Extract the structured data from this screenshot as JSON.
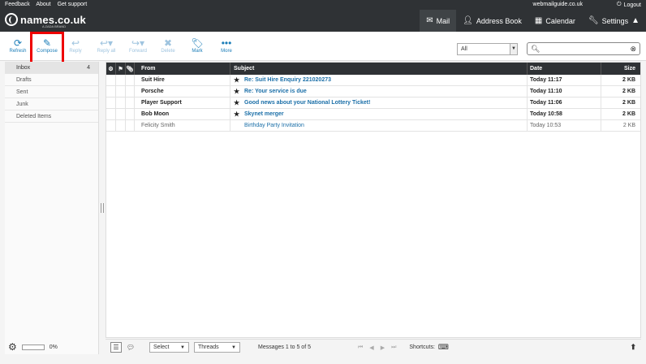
{
  "app": {
    "brand": "names.co.uk",
    "brand_sub": "A ZADA BRAND",
    "top_links": [
      "Feedback",
      "About",
      "Get support"
    ],
    "username": "webmailguide.co.uk",
    "logout_label": "Logout"
  },
  "nav": {
    "mail": "Mail",
    "address_book": "Address Book",
    "calendar": "Calendar",
    "settings": "Settings"
  },
  "toolbar": {
    "refresh": "Refresh",
    "compose": "Compose",
    "reply": "Reply",
    "reply_all": "Reply all",
    "forward": "Forward",
    "delete": "Delete",
    "mark": "Mark",
    "more": "More"
  },
  "filter": {
    "selected": "All"
  },
  "search": {
    "value": ""
  },
  "folders": [
    {
      "name": "Inbox",
      "count": "4"
    },
    {
      "name": "Drafts",
      "count": ""
    },
    {
      "name": "Sent",
      "count": ""
    },
    {
      "name": "Junk",
      "count": ""
    },
    {
      "name": "Deleted Items",
      "count": ""
    }
  ],
  "quota": {
    "percent": "0%",
    "fraction": 0
  },
  "list": {
    "headers": {
      "from": "From",
      "subject": "Subject",
      "date": "Date",
      "size": "Size"
    },
    "messages": [
      {
        "from": "Suit Hire",
        "subject": "Re: Suit Hire Enquiry 221020273",
        "date": "Today 11:17",
        "size": "2 KB",
        "unread": true
      },
      {
        "from": "Porsche",
        "subject": "Re: Your service is due",
        "date": "Today 11:10",
        "size": "2 KB",
        "unread": true
      },
      {
        "from": "Player Support",
        "subject": "Good news about your National Lottery Ticket!",
        "date": "Today 11:06",
        "size": "2 KB",
        "unread": true
      },
      {
        "from": "Bob Moon",
        "subject": "Skynet merger",
        "date": "Today 10:58",
        "size": "2 KB",
        "unread": true
      },
      {
        "from": "Felicity Smith",
        "subject": "Birthday Party Invitation",
        "date": "Today 10:53",
        "size": "2 KB",
        "unread": false
      }
    ]
  },
  "bottom": {
    "select_label": "Select",
    "threads_label": "Threads",
    "count_text": "Messages 1 to 5 of 5",
    "shortcuts_label": "Shortcuts:"
  },
  "colors": {
    "header_bg": "#2f3235",
    "accent": "#1b7db8",
    "highlight": "#e00000"
  }
}
